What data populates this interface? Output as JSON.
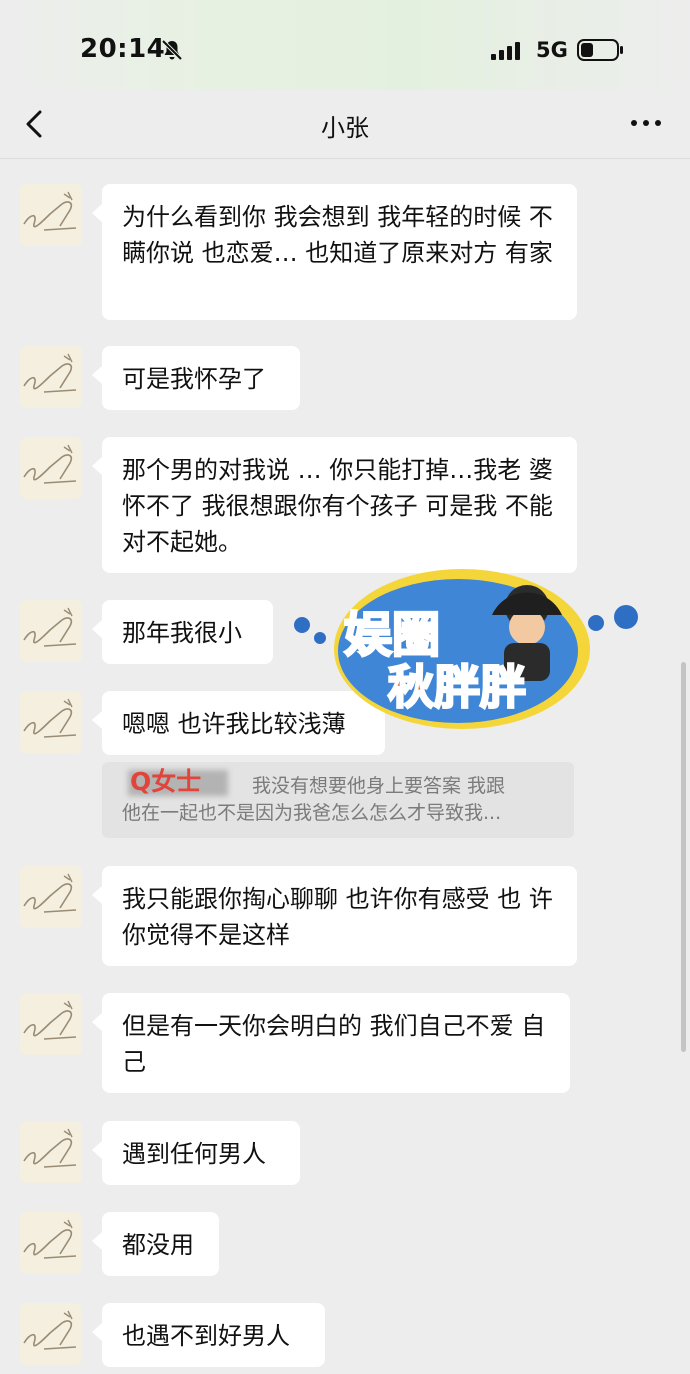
{
  "status": {
    "time": "20:14",
    "network": "5G"
  },
  "chat": {
    "title": "小张"
  },
  "messages": [
    {
      "text": "为什么看到你 我会想到 我年轻的时候 不瞒你说 也恋爱… 也知道了原来对方 有家"
    },
    {
      "text": "可是我怀孕了"
    },
    {
      "text": "那个男的对我说 … 你只能打掉…我老 婆怀不了 我很想跟你有个孩子 可是我 不能对不起她。"
    },
    {
      "text": "那年我很小"
    },
    {
      "text": "嗯嗯 也许我比较浅薄"
    },
    {
      "text": "我只能跟你掏心聊聊 也许你有感受 也 许你觉得不是这样"
    },
    {
      "text": "但是有一天你会明白的 我们自己不爱 自己"
    },
    {
      "text": "遇到任何男人"
    },
    {
      "text": "都没用"
    },
    {
      "text": "也遇不到好男人"
    }
  ],
  "quote": {
    "sender": "Q女士",
    "line1": "我没有想要他身上要答案 我跟",
    "line2": "他在一起也不是因为我爸怎么怎么才导致我..."
  },
  "watermark": {
    "line1": "娱圈",
    "line2": "秋胖胖"
  },
  "colors": {
    "background": "#ededed",
    "bubble": "#ffffff",
    "quote_bg": "#e3e3e3",
    "sender_red": "#e0443a",
    "watermark_blue": "#2e6fc4"
  }
}
